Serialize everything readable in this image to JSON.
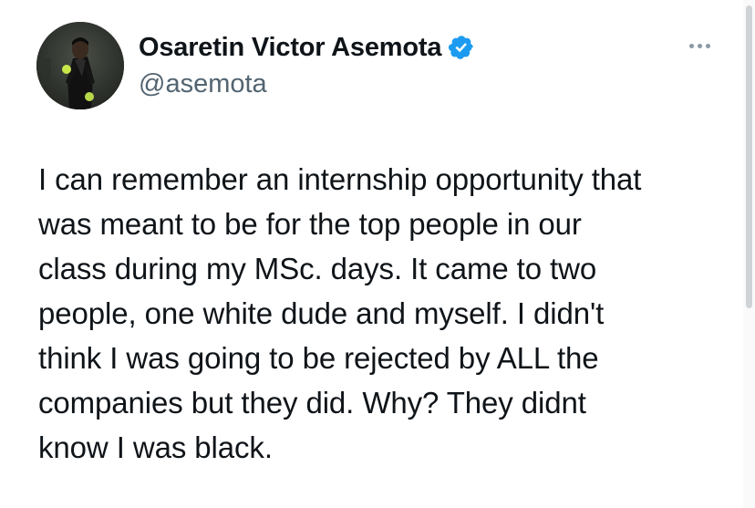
{
  "author": {
    "display_name": "Osaretin Victor Asemota",
    "handle": "@asemota",
    "verified": true,
    "avatar_icon": "profile-photo"
  },
  "tweet": {
    "text": "I can remember an internship opportunity that\nwas meant to be for the top people in our\nclass during my MSc. days. It came to two\npeople, one white dude and myself. I didn't\nthink I was going to be rejected by ALL the\ncompanies but they did. Why? They didnt\nknow I was black."
  },
  "icons": {
    "verified": "verified-badge-icon",
    "more": "more-options-icon"
  },
  "colors": {
    "text": "#0f1419",
    "secondary_text": "#536471",
    "verified_blue": "#1d9bf0",
    "background": "#ffffff"
  }
}
